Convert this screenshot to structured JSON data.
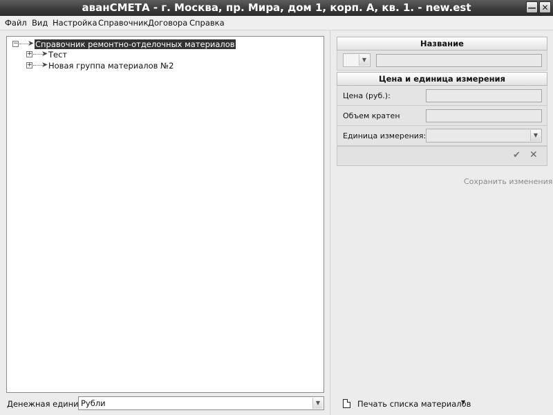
{
  "window": {
    "title": "аванСМЕТА - г. Москва, пр. Мира, дом 1, корп. А, кв. 1. - new.est",
    "minimize_icon": "minimize-icon",
    "close_icon": "close-icon"
  },
  "menu": {
    "items": [
      "Файл",
      "Вид",
      "Настройка",
      "Справочник",
      "Договора",
      "Справка"
    ]
  },
  "tree": {
    "root": {
      "label": "Справочник ремонтно-отделочных материалов",
      "expander": "⊟",
      "selected": true
    },
    "children": [
      {
        "label": "Тест",
        "expander": "⊞"
      },
      {
        "label": "Новая группа материалов №2",
        "expander": "⊞"
      }
    ]
  },
  "currency": {
    "label": "Денежная единица:",
    "value": "Рубли"
  },
  "details": {
    "name_header": "Название",
    "name_value": "",
    "price_header": "Цена и единица измерения",
    "price_label": "Цена (руб.):",
    "price_value": "",
    "multiple_label": "Объем кратен",
    "multiple_value": "",
    "unit_label": "Единица измерения:",
    "unit_value": "",
    "confirm_icon": "check-icon",
    "cancel_icon": "close-x-icon",
    "save_label": "Сохранить изменения"
  },
  "print": {
    "label": "Печать списка материалов",
    "icon": "document-icon"
  }
}
